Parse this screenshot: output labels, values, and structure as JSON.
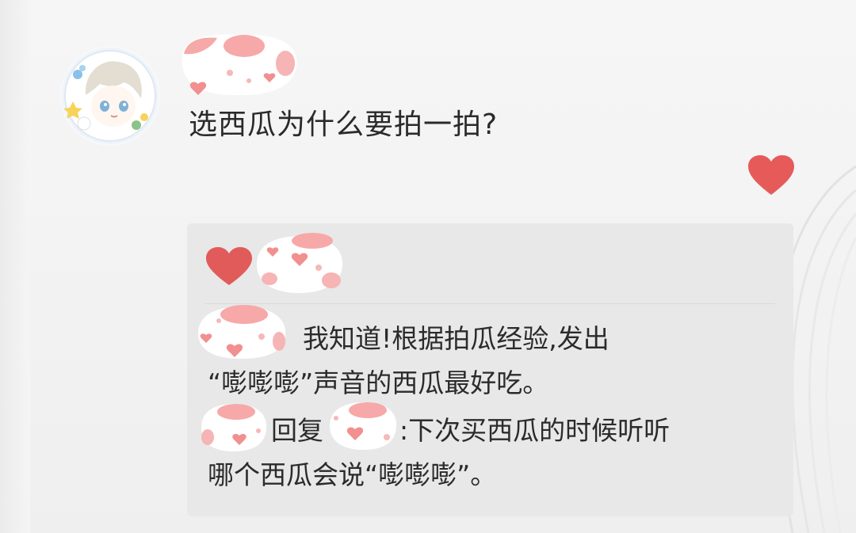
{
  "post": {
    "avatar_icon": "anime-avatar-icon",
    "username_sticker": "sticker-mask-icon",
    "text": "选西瓜为什么要拍一拍?",
    "like_icon": "heart-icon",
    "like_color": "#e65a5a"
  },
  "comments": {
    "likes_icon": "heart-icon",
    "items": [
      {
        "line1": "我知道!根据拍瓜经验,发出",
        "line2": "“嘭嘭嘭”声音的西瓜最好吃。"
      },
      {
        "reply_label": "回复",
        "line1": ":下次买西瓜的时候听听",
        "line2": "哪个西瓜会说“嘭嘭嘭”。"
      }
    ]
  },
  "colors": {
    "background": "#f3f3f3",
    "comment_box": "#e8e8e8",
    "text": "#2a2a2a",
    "sticker_pink": "#f29a9a"
  }
}
